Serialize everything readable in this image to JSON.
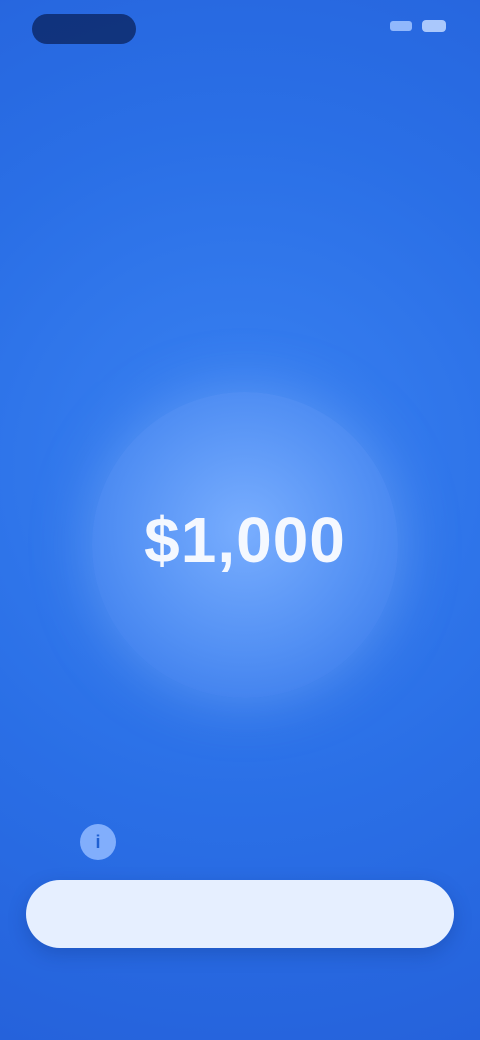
{
  "status": {
    "left_badge": "",
    "right_icons": [
      "signal-icon",
      "battery-icon"
    ]
  },
  "header": {
    "brand": "",
    "title": "",
    "subtitle": ""
  },
  "balance": {
    "amount": "$1,000",
    "caption": ""
  },
  "notice": {
    "icon": "info-icon",
    "text": ""
  },
  "cta": {
    "label": ""
  },
  "colors": {
    "background": "#2a6fe6",
    "button": "#e6efff",
    "button_text": "#2a62d6"
  }
}
